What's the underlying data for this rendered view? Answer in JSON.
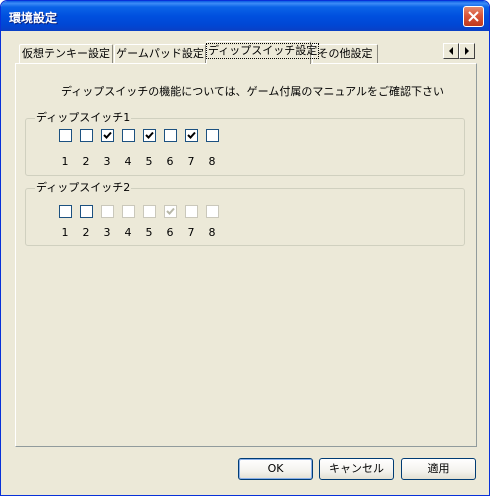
{
  "window": {
    "title": "環境設定"
  },
  "tabs": [
    {
      "label": "仮想テンキー設定"
    },
    {
      "label": "ゲームパッド設定"
    },
    {
      "label": "ディップスイッチ設定"
    },
    {
      "label": "その他設定"
    }
  ],
  "active_tab": "ディップスイッチ設定",
  "note": "ディップスイッチの機能については、ゲーム付属のマニュアルをご確認下さい",
  "dip_groups": [
    {
      "label": "ディップスイッチ1",
      "enabled": true,
      "switches": [
        {
          "number": "1",
          "checked": false
        },
        {
          "number": "2",
          "checked": false
        },
        {
          "number": "3",
          "checked": true
        },
        {
          "number": "4",
          "checked": false
        },
        {
          "number": "5",
          "checked": true
        },
        {
          "number": "6",
          "checked": false
        },
        {
          "number": "7",
          "checked": true
        },
        {
          "number": "8",
          "checked": false
        }
      ]
    },
    {
      "label": "ディップスイッチ2",
      "enabled_switches": [
        true,
        true,
        false,
        false,
        false,
        false,
        false,
        false
      ],
      "switches": [
        {
          "number": "1",
          "checked": false
        },
        {
          "number": "2",
          "checked": false
        },
        {
          "number": "3",
          "checked": false
        },
        {
          "number": "4",
          "checked": false
        },
        {
          "number": "5",
          "checked": false
        },
        {
          "number": "6",
          "checked": true
        },
        {
          "number": "7",
          "checked": false
        },
        {
          "number": "8",
          "checked": false
        }
      ]
    }
  ],
  "buttons": {
    "ok": "OK",
    "cancel": "キャンセル",
    "apply": "適用"
  },
  "colors": {
    "titlebar": "#0054e3",
    "face": "#ece9d8",
    "close": "#d9553a"
  }
}
